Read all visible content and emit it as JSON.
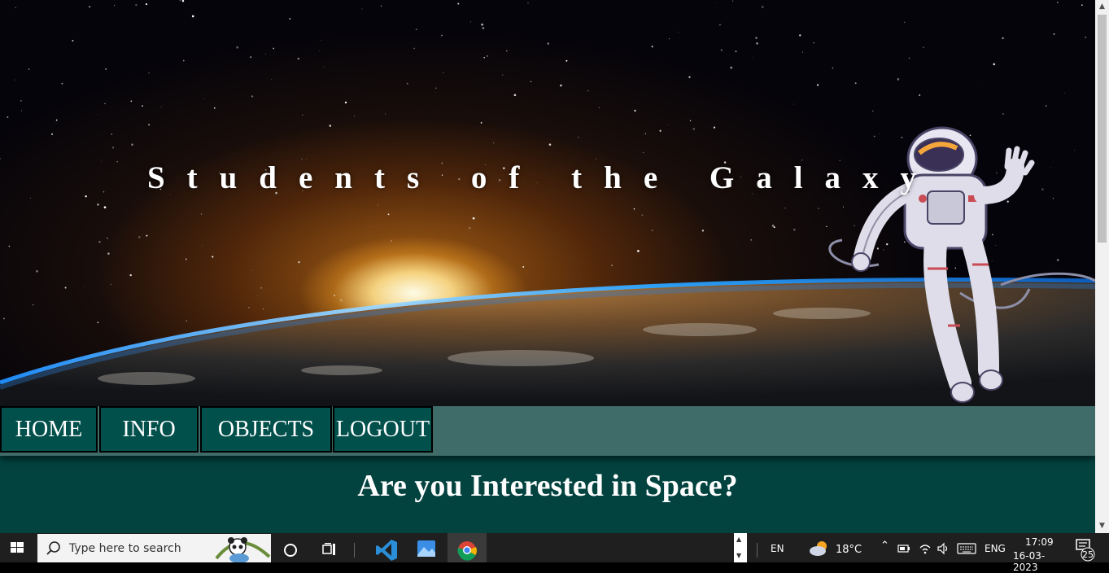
{
  "hero": {
    "title": "Students of the Galaxy"
  },
  "nav": {
    "items": [
      {
        "label": "HOME"
      },
      {
        "label": "INFO"
      },
      {
        "label": "OBJECTS"
      },
      {
        "label": "LOGOUT"
      }
    ]
  },
  "main": {
    "headline": "Are you Interested in Space?"
  },
  "taskbar": {
    "search_placeholder": "Type here to search",
    "language_short": "EN",
    "temperature": "18°C",
    "keyboard_layout": "ENG",
    "time": "17:09",
    "date": "16-03-2023",
    "notification_count": "25"
  },
  "colors": {
    "nav_button_bg": "#02504c",
    "navbar_bg": "#3f6b69",
    "content_bg": "#02423f"
  }
}
